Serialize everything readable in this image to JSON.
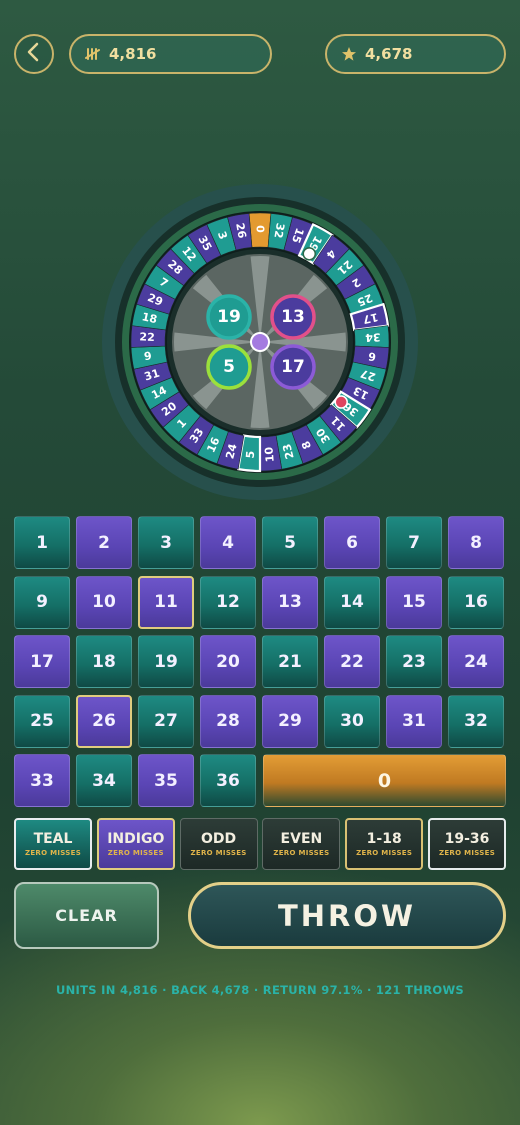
{
  "header": {
    "units_value": "4,816",
    "back_value": "4,678"
  },
  "wheel": {
    "pockets": [
      {
        "n": "0",
        "c": "orange"
      },
      {
        "n": "32",
        "c": "teal"
      },
      {
        "n": "15",
        "c": "indigo"
      },
      {
        "n": "19",
        "c": "teal"
      },
      {
        "n": "4",
        "c": "indigo"
      },
      {
        "n": "21",
        "c": "teal"
      },
      {
        "n": "2",
        "c": "indigo"
      },
      {
        "n": "25",
        "c": "teal"
      },
      {
        "n": "17",
        "c": "indigo"
      },
      {
        "n": "34",
        "c": "teal"
      },
      {
        "n": "6",
        "c": "indigo"
      },
      {
        "n": "27",
        "c": "teal"
      },
      {
        "n": "13",
        "c": "indigo"
      },
      {
        "n": "36",
        "c": "teal"
      },
      {
        "n": "11",
        "c": "indigo"
      },
      {
        "n": "30",
        "c": "teal"
      },
      {
        "n": "8",
        "c": "indigo"
      },
      {
        "n": "23",
        "c": "teal"
      },
      {
        "n": "10",
        "c": "indigo"
      },
      {
        "n": "5",
        "c": "teal"
      },
      {
        "n": "24",
        "c": "indigo"
      },
      {
        "n": "16",
        "c": "teal"
      },
      {
        "n": "33",
        "c": "indigo"
      },
      {
        "n": "1",
        "c": "teal"
      },
      {
        "n": "20",
        "c": "indigo"
      },
      {
        "n": "14",
        "c": "teal"
      },
      {
        "n": "31",
        "c": "indigo"
      },
      {
        "n": "9",
        "c": "teal"
      },
      {
        "n": "22",
        "c": "indigo"
      },
      {
        "n": "18",
        "c": "teal"
      },
      {
        "n": "29",
        "c": "indigo"
      },
      {
        "n": "7",
        "c": "teal"
      },
      {
        "n": "28",
        "c": "indigo"
      },
      {
        "n": "12",
        "c": "teal"
      },
      {
        "n": "35",
        "c": "indigo"
      },
      {
        "n": "3",
        "c": "teal"
      },
      {
        "n": "26",
        "c": "indigo"
      }
    ],
    "highlighted_pockets": [
      "19",
      "17",
      "36",
      "5"
    ],
    "white_marker_pocket": "19",
    "red_marker_pocket": "36",
    "center_balls": [
      {
        "n": "19",
        "ring": "#2bb3a8"
      },
      {
        "n": "13",
        "ring": "#e2508a"
      },
      {
        "n": "5",
        "ring": "#9be03c"
      },
      {
        "n": "17",
        "ring": "#8c5bd6"
      }
    ],
    "colors": {
      "teal": "#1f9c92",
      "indigo": "#4b3c9e",
      "orange": "#e39a30"
    }
  },
  "board": {
    "numbers": [
      {
        "n": "1",
        "c": "teal"
      },
      {
        "n": "2",
        "c": "indigo"
      },
      {
        "n": "3",
        "c": "teal"
      },
      {
        "n": "4",
        "c": "indigo"
      },
      {
        "n": "5",
        "c": "teal"
      },
      {
        "n": "6",
        "c": "indigo"
      },
      {
        "n": "7",
        "c": "teal"
      },
      {
        "n": "8",
        "c": "indigo"
      },
      {
        "n": "9",
        "c": "teal"
      },
      {
        "n": "10",
        "c": "indigo"
      },
      {
        "n": "11",
        "c": "indigo"
      },
      {
        "n": "12",
        "c": "teal"
      },
      {
        "n": "13",
        "c": "indigo"
      },
      {
        "n": "14",
        "c": "teal"
      },
      {
        "n": "15",
        "c": "indigo"
      },
      {
        "n": "16",
        "c": "teal"
      },
      {
        "n": "17",
        "c": "indigo"
      },
      {
        "n": "18",
        "c": "teal"
      },
      {
        "n": "19",
        "c": "teal"
      },
      {
        "n": "20",
        "c": "indigo"
      },
      {
        "n": "21",
        "c": "teal"
      },
      {
        "n": "22",
        "c": "indigo"
      },
      {
        "n": "23",
        "c": "teal"
      },
      {
        "n": "24",
        "c": "indigo"
      },
      {
        "n": "25",
        "c": "teal"
      },
      {
        "n": "26",
        "c": "indigo"
      },
      {
        "n": "27",
        "c": "teal"
      },
      {
        "n": "28",
        "c": "indigo"
      },
      {
        "n": "29",
        "c": "indigo"
      },
      {
        "n": "30",
        "c": "teal"
      },
      {
        "n": "31",
        "c": "indigo"
      },
      {
        "n": "32",
        "c": "teal"
      },
      {
        "n": "33",
        "c": "indigo"
      },
      {
        "n": "34",
        "c": "teal"
      },
      {
        "n": "35",
        "c": "indigo"
      },
      {
        "n": "36",
        "c": "teal"
      }
    ],
    "highlighted_numbers": [
      "11",
      "26"
    ],
    "zero_label": "0"
  },
  "outside_bets": [
    {
      "label": "TEAL",
      "sub": "ZERO MISSES",
      "style": "teal"
    },
    {
      "label": "INDIGO",
      "sub": "ZERO MISSES",
      "style": "indigo"
    },
    {
      "label": "ODD",
      "sub": "ZERO MISSES",
      "style": "dark"
    },
    {
      "label": "EVEN",
      "sub": "ZERO MISSES",
      "style": "dark"
    },
    {
      "label": "1-18",
      "sub": "ZERO MISSES",
      "style": "dark gold"
    },
    {
      "label": "19-36",
      "sub": "ZERO MISSES",
      "style": "dark white"
    }
  ],
  "actions": {
    "clear_label": "CLEAR",
    "throw_label": "THROW"
  },
  "stats_line": "UNITS IN 4,816 · BACK 4,678 · RETURN 97.1% · 121 THROWS"
}
